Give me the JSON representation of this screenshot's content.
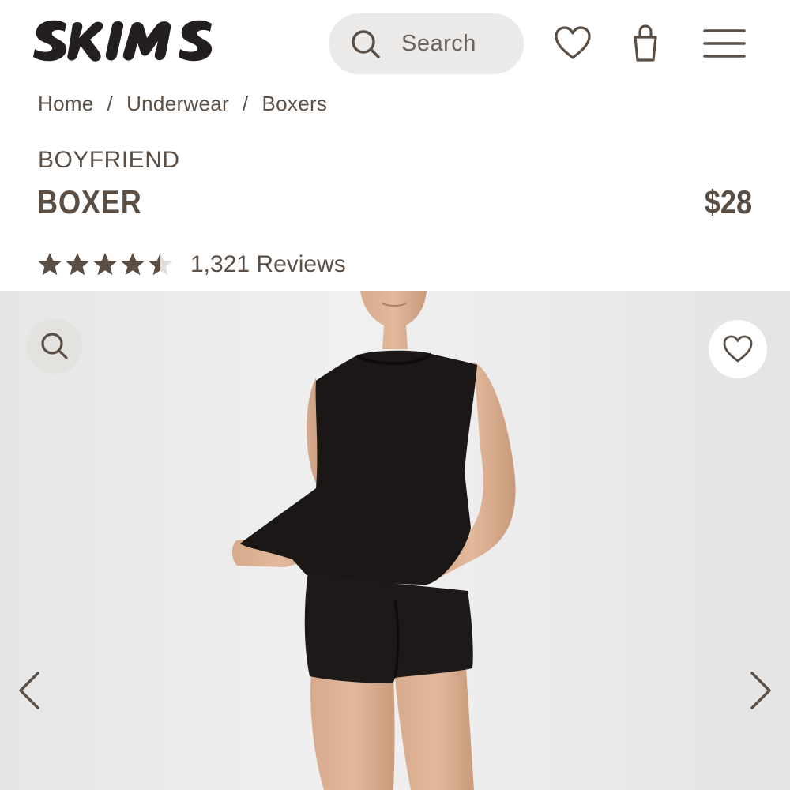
{
  "header": {
    "logo_text": "SKIMS",
    "search_placeholder": "Search",
    "icons": [
      "search-icon",
      "heart-icon",
      "shopping-bag-icon",
      "hamburger-menu-icon"
    ]
  },
  "breadcrumb": {
    "items": [
      "Home",
      "Underwear",
      "Boxers"
    ],
    "separator": "/"
  },
  "product": {
    "subtitle": "BOYFRIEND",
    "title": "BOXER",
    "price": "$28",
    "rating": 4.5,
    "rating_max": 5,
    "reviews_label": "1,321 Reviews"
  },
  "gallery": {
    "icons": [
      "zoom-icon",
      "heart-icon",
      "chevron-left-icon",
      "chevron-right-icon"
    ]
  },
  "colors": {
    "text_brown": "#5b4f45",
    "search_bg": "#ebeae8",
    "gallery_bg": "#eeeeee",
    "logo": "#231f20"
  }
}
